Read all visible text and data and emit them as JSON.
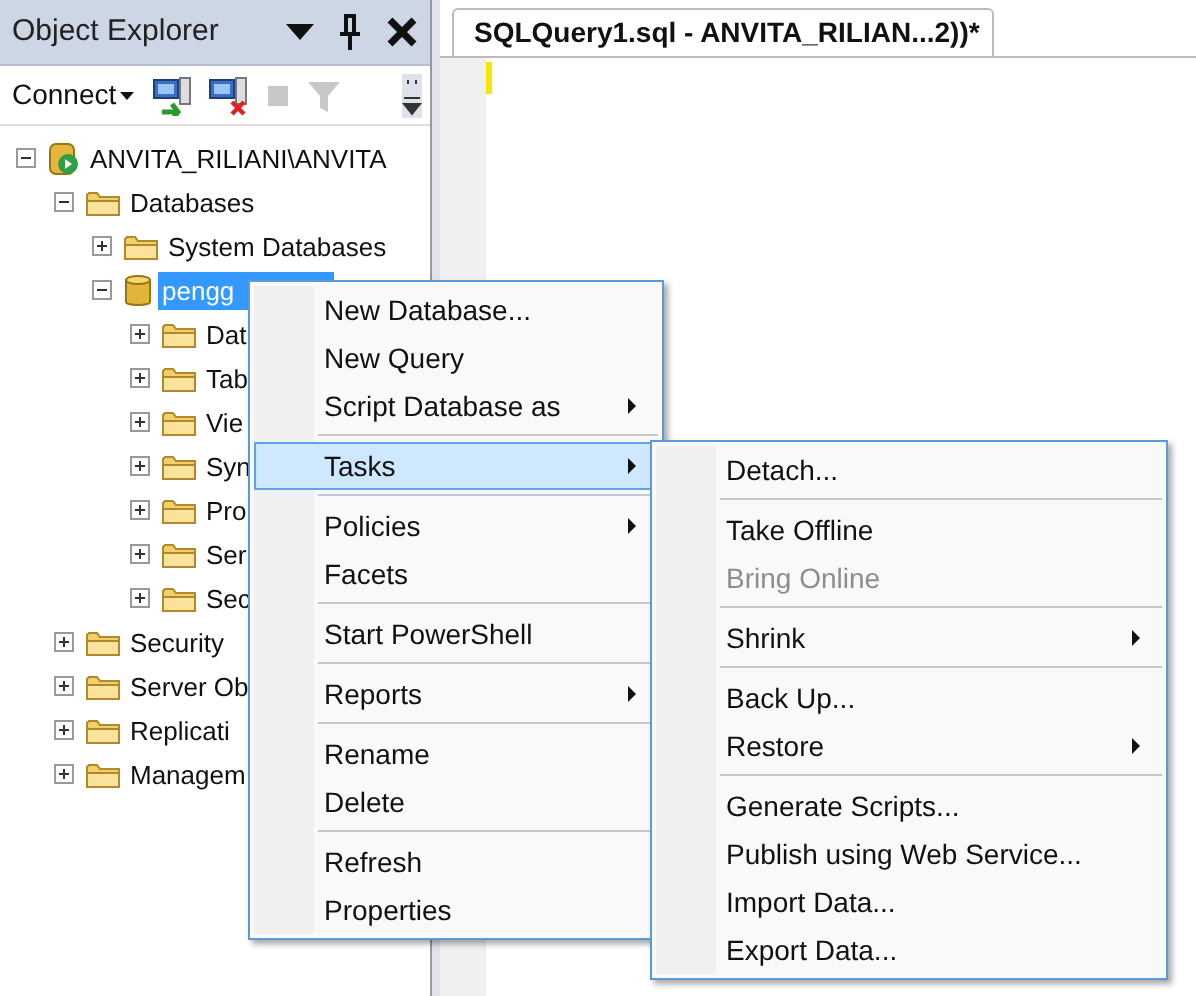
{
  "object_explorer": {
    "title": "Object Explorer",
    "connect_label": "Connect",
    "tree": [
      {
        "label": "ANVITA_RILIANI\\ANVITA",
        "kind": "server",
        "expanded": true,
        "selected": false,
        "children": [
          {
            "label": "Databases",
            "kind": "folder",
            "expanded": true,
            "selected": false,
            "children": [
              {
                "label": "System Databases",
                "kind": "folder",
                "expanded": false,
                "selected": false
              },
              {
                "label": "pengg",
                "kind": "database",
                "expanded": true,
                "selected": true,
                "children": [
                  {
                    "label": "Dat",
                    "kind": "folder",
                    "expanded": false,
                    "selected": false
                  },
                  {
                    "label": "Tab",
                    "kind": "folder",
                    "expanded": false,
                    "selected": false
                  },
                  {
                    "label": "Vie",
                    "kind": "folder",
                    "expanded": false,
                    "selected": false
                  },
                  {
                    "label": "Syn",
                    "kind": "folder",
                    "expanded": false,
                    "selected": false
                  },
                  {
                    "label": "Pro",
                    "kind": "folder",
                    "expanded": false,
                    "selected": false
                  },
                  {
                    "label": "Ser",
                    "kind": "folder",
                    "expanded": false,
                    "selected": false
                  },
                  {
                    "label": "Sec",
                    "kind": "folder",
                    "expanded": false,
                    "selected": false
                  }
                ]
              }
            ]
          },
          {
            "label": "Security",
            "kind": "folder",
            "expanded": false,
            "selected": false
          },
          {
            "label": "Server Ob",
            "kind": "folder",
            "expanded": false,
            "selected": false
          },
          {
            "label": "Replicati",
            "kind": "folder",
            "expanded": false,
            "selected": false
          },
          {
            "label": "Managem",
            "kind": "folder",
            "expanded": false,
            "selected": false
          }
        ]
      }
    ]
  },
  "editor": {
    "tab": {
      "title": "SQLQuery1.sql - ANVITA_RILIAN...2))*",
      "selected": true
    }
  },
  "context_menu": {
    "items": [
      {
        "kind": "item",
        "label": "New Database...",
        "submenu": false,
        "selected": false,
        "disabled": false
      },
      {
        "kind": "item",
        "label": "New Query",
        "submenu": false,
        "selected": false,
        "disabled": false
      },
      {
        "kind": "item",
        "label": "Script Database as",
        "submenu": true,
        "selected": false,
        "disabled": false
      },
      {
        "kind": "separator"
      },
      {
        "kind": "item",
        "label": "Tasks",
        "submenu": true,
        "selected": true,
        "disabled": false
      },
      {
        "kind": "separator"
      },
      {
        "kind": "item",
        "label": "Policies",
        "submenu": true,
        "selected": false,
        "disabled": false
      },
      {
        "kind": "item",
        "label": "Facets",
        "submenu": false,
        "selected": false,
        "disabled": false
      },
      {
        "kind": "separator"
      },
      {
        "kind": "item",
        "label": "Start PowerShell",
        "submenu": false,
        "selected": false,
        "disabled": false
      },
      {
        "kind": "separator"
      },
      {
        "kind": "item",
        "label": "Reports",
        "submenu": true,
        "selected": false,
        "disabled": false
      },
      {
        "kind": "separator"
      },
      {
        "kind": "item",
        "label": "Rename",
        "submenu": false,
        "selected": false,
        "disabled": false
      },
      {
        "kind": "item",
        "label": "Delete",
        "submenu": false,
        "selected": false,
        "disabled": false
      },
      {
        "kind": "separator"
      },
      {
        "kind": "item",
        "label": "Refresh",
        "submenu": false,
        "selected": false,
        "disabled": false
      },
      {
        "kind": "item",
        "label": "Properties",
        "submenu": false,
        "selected": false,
        "disabled": false
      }
    ]
  },
  "tasks_submenu": {
    "items": [
      {
        "kind": "item",
        "label": "Detach...",
        "submenu": false,
        "selected": false,
        "disabled": false
      },
      {
        "kind": "separator"
      },
      {
        "kind": "item",
        "label": "Take Offline",
        "submenu": false,
        "selected": false,
        "disabled": false
      },
      {
        "kind": "item",
        "label": "Bring Online",
        "submenu": false,
        "selected": false,
        "disabled": true
      },
      {
        "kind": "separator"
      },
      {
        "kind": "item",
        "label": "Shrink",
        "submenu": true,
        "selected": false,
        "disabled": false
      },
      {
        "kind": "separator"
      },
      {
        "kind": "item",
        "label": "Back Up...",
        "submenu": false,
        "selected": false,
        "disabled": false
      },
      {
        "kind": "item",
        "label": "Restore",
        "submenu": true,
        "selected": false,
        "disabled": false
      },
      {
        "kind": "separator"
      },
      {
        "kind": "item",
        "label": "Generate Scripts...",
        "submenu": false,
        "selected": false,
        "disabled": false
      },
      {
        "kind": "item",
        "label": "Publish using Web Service...",
        "submenu": false,
        "selected": false,
        "disabled": false
      },
      {
        "kind": "item",
        "label": "Import Data...",
        "submenu": false,
        "selected": false,
        "disabled": false
      },
      {
        "kind": "item",
        "label": "Export Data...",
        "submenu": false,
        "selected": false,
        "disabled": false
      }
    ]
  }
}
